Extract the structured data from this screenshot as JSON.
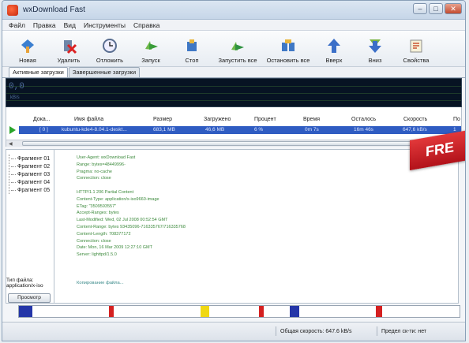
{
  "window": {
    "title": "wxDownload Fast"
  },
  "menu": [
    "Файл",
    "Правка",
    "Вид",
    "Инструменты",
    "Справка"
  ],
  "toolbar": [
    {
      "label": "Новая",
      "icon": "new-download-icon"
    },
    {
      "label": "Удалить",
      "icon": "delete-icon"
    },
    {
      "label": "Отложить",
      "icon": "schedule-icon"
    },
    {
      "label": "Запуск",
      "icon": "start-icon"
    },
    {
      "label": "Стоп",
      "icon": "stop-icon"
    },
    {
      "label": "Запустить все",
      "icon": "start-all-icon"
    },
    {
      "label": "Остановить все",
      "icon": "stop-all-icon"
    },
    {
      "label": "Вверх",
      "icon": "move-up-icon"
    },
    {
      "label": "Вниз",
      "icon": "move-down-icon"
    },
    {
      "label": "Свойства",
      "icon": "properties-icon"
    }
  ],
  "tabs": [
    "Активные загрузки",
    "Завершенные загрузки"
  ],
  "graph": {
    "value": "0,0",
    "unit": "kB/s"
  },
  "columns": [
    "Дока...",
    "Имя файла",
    "Размер",
    "Загружено",
    "Процент",
    "Время",
    "Осталось",
    "Скорость",
    "По"
  ],
  "row": [
    "[ 0 ]",
    "kubuntu-kde4-8.04.1-deskt...",
    "683,1 MB",
    "46,6 MB",
    "6 %",
    "0m 7s",
    "16m 46s",
    "647,6 kB/s",
    "1"
  ],
  "fragments": [
    "Фрагмент 01",
    "Фрагмент 02",
    "Фрагмент 03",
    "Фрагмент 04",
    "Фрагмент 05"
  ],
  "filetype": {
    "label": "Тип файла:",
    "value": "application/x-iso"
  },
  "preview_label": "Просмотр",
  "log": [
    "User-Agent: wxDownload Fast",
    "Range: bytes=48449996-",
    "Pragma: no-cache",
    "Connection: close",
    "",
    "HTTP/1.1 206 Partial Content",
    "Content-Type: application/x-iso9660-image",
    "ETag: \"3509593557\"",
    "Accept-Ranges: bytes",
    "Last-Modified: Wed, 02 Jul 2008 00:52:54 GMT",
    "Content-Range: bytes 93435096-716335767/716335768",
    "Content-Length: 708377172",
    "Connection: close",
    "Date: Mon, 16 Mar 2009 12:27:10 GMT",
    "Server: lighttpd/1.5.0"
  ],
  "log_footer": "Копирование файла...",
  "banner": "FRE",
  "progress_segments": [
    {
      "start": 0.0,
      "end": 0.03,
      "color": "#2436a8"
    },
    {
      "start": 0.205,
      "end": 0.215,
      "color": "#d42020"
    },
    {
      "start": 0.412,
      "end": 0.432,
      "color": "#f0d812"
    },
    {
      "start": 0.545,
      "end": 0.555,
      "color": "#d42020"
    },
    {
      "start": 0.615,
      "end": 0.637,
      "color": "#2436a8"
    },
    {
      "start": 0.81,
      "end": 0.825,
      "color": "#d42020"
    }
  ],
  "status": {
    "speed": "Общая скорость: 647.6 kB/s",
    "limit": "Предел ск-ти: нет"
  }
}
